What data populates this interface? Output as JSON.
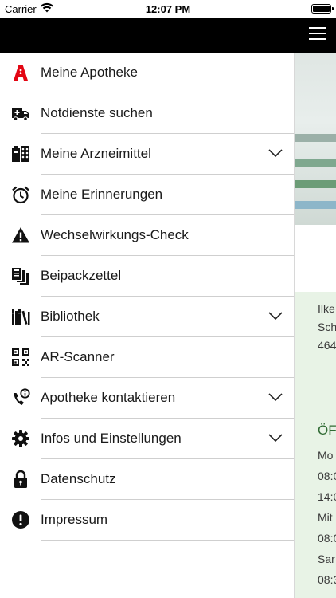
{
  "status_bar": {
    "carrier": "Carrier",
    "time": "12:07 PM"
  },
  "nav": {
    "menu_icon": "hamburger-icon"
  },
  "menu": {
    "items": [
      {
        "label": "Meine Apotheke",
        "icon": "pharmacy-icon",
        "expandable": false
      },
      {
        "label": "Notdienste suchen",
        "icon": "ambulance-icon",
        "expandable": false
      },
      {
        "label": "Meine Arzneimittel",
        "icon": "medication-icon",
        "expandable": true
      },
      {
        "label": "Meine Erinnerungen",
        "icon": "alarm-clock-icon",
        "expandable": false
      },
      {
        "label": "Wechselwirkungs-Check",
        "icon": "warning-icon",
        "expandable": false
      },
      {
        "label": "Beipackzettel",
        "icon": "leaflet-icon",
        "expandable": false
      },
      {
        "label": "Bibliothek",
        "icon": "library-icon",
        "expandable": true
      },
      {
        "label": "AR-Scanner",
        "icon": "qr-code-icon",
        "expandable": false
      },
      {
        "label": "Apotheke kontaktieren",
        "icon": "phone-info-icon",
        "expandable": true
      },
      {
        "label": "Infos und Einstellungen",
        "icon": "gear-icon",
        "expandable": true
      },
      {
        "label": "Datenschutz",
        "icon": "lock-icon",
        "expandable": false
      },
      {
        "label": "Impressum",
        "icon": "info-exclamation-icon",
        "expandable": false
      }
    ]
  },
  "background": {
    "address_lines": [
      "Ilke",
      "Sch",
      "464"
    ],
    "opening_title": "ÖF",
    "opening_lines": [
      "Mo",
      "08:0",
      "14:0",
      "Mit",
      "08:0",
      "Sar",
      "08:3"
    ]
  },
  "colors": {
    "nav_bar": "#000000",
    "pharmacy_red": "#e30613",
    "background_panel": "#e8f3e6",
    "accent_green": "#2f6a33"
  }
}
